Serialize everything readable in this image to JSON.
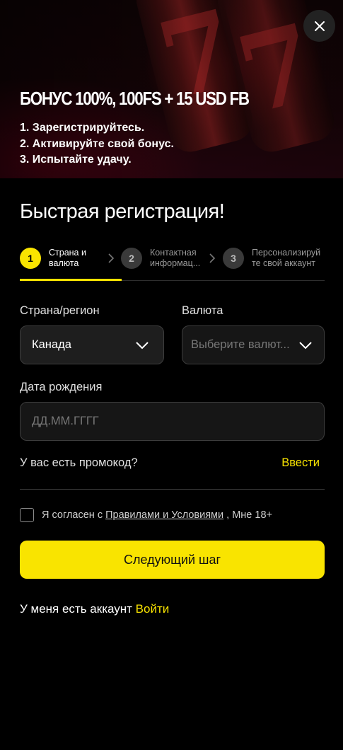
{
  "banner": {
    "bonus_title": "БОНУС 100%, 100FS + 15 USD FB",
    "steps": [
      "1. Зарегистрируйтесь.",
      "2. Активируйте свой бонус.",
      "3. Испытайте удачу."
    ],
    "decor_glyph": "7"
  },
  "close_icon": "close-icon",
  "page_title": "Быстрая регистрация!",
  "stepper": {
    "steps": [
      {
        "number": "1",
        "label_line1": "Страна и",
        "label_line2": "валюта",
        "active": true
      },
      {
        "number": "2",
        "label_line1": "Контактная",
        "label_line2": "информац...",
        "active": false
      },
      {
        "number": "3",
        "label_line1": "Персонализируй",
        "label_line2": "те свой аккаунт",
        "active": false
      }
    ]
  },
  "form": {
    "country_label": "Страна/регион",
    "country_value": "Канада",
    "currency_label": "Валюта",
    "currency_placeholder": "Выберите валют...",
    "dob_label": "Дата рождения",
    "dob_placeholder": "ДД.ММ.ГГГГ",
    "promo_question": "У вас есть промокод?",
    "promo_link": "Ввести",
    "agree_prefix": "Я согласен с ",
    "agree_link": "Правилами и Условиями",
    "agree_suffix": " , Мне 18+",
    "agree_checked": false,
    "next_button": "Следующий шаг"
  },
  "footer": {
    "account_question": "У меня есть аккаунт ",
    "login_link": "Войти"
  },
  "colors": {
    "accent": "#f9e400",
    "background": "#000000",
    "field_border": "#3d3d3d"
  }
}
